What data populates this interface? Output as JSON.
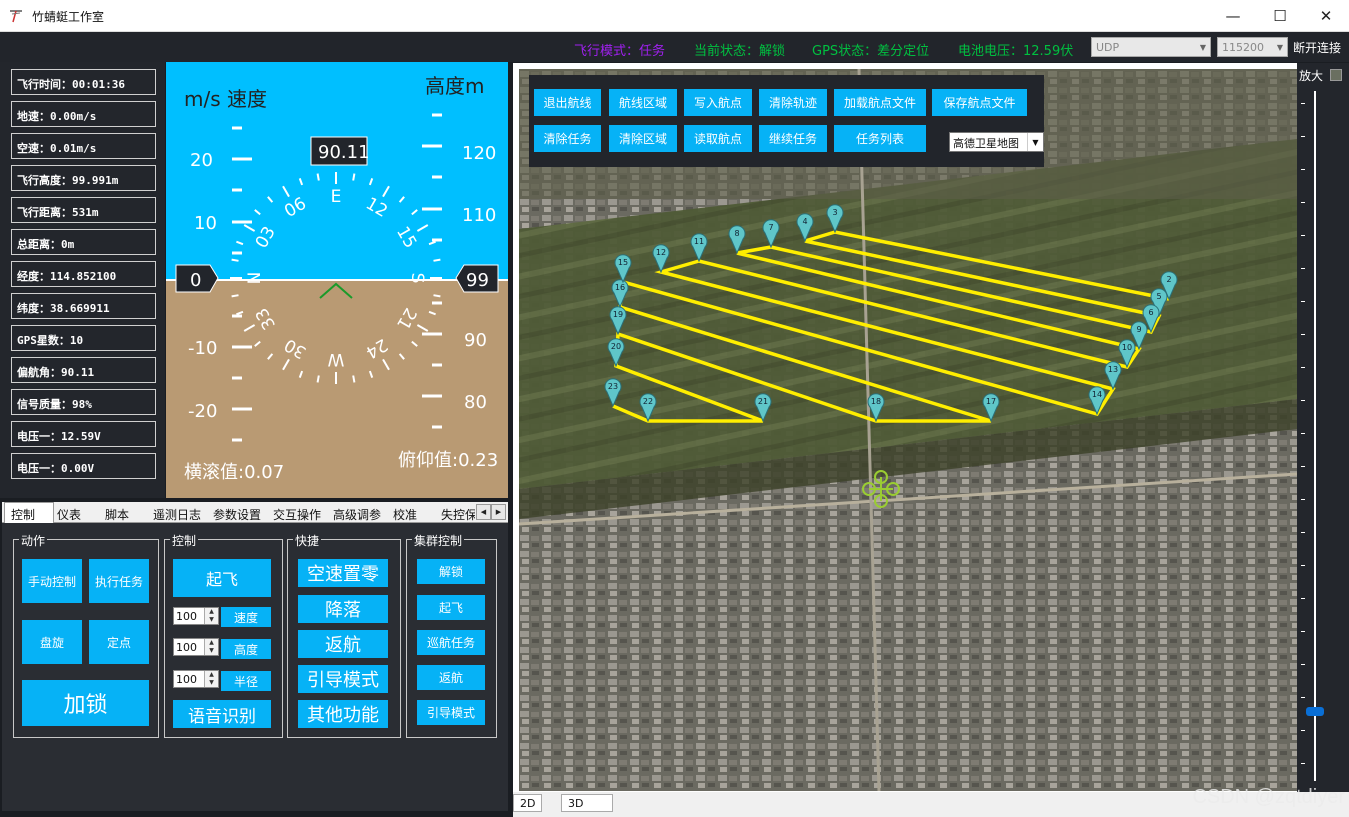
{
  "window": {
    "title": "竹蜻蜓工作室",
    "minimize": "—",
    "maximize": "☐",
    "close": "✕"
  },
  "status": {
    "flight_mode": "飞行模式：任务",
    "current_state": "当前状态：解锁",
    "gps_state": "GPS状态：差分定位",
    "battery": "电池电压：12.59伏",
    "protocol": "UDP",
    "baud": "115200",
    "disconnect": "断开连接",
    "colors": {
      "flight_mode": "#a020f0",
      "current_state": "#00c040",
      "gps_state": "#00c040",
      "battery": "#00c040"
    }
  },
  "telemetry": [
    "飞行时间：00:01:36",
    "地速：0.00m/s",
    "空速：0.01m/s",
    "飞行高度：99.991m",
    "飞行距离：531m",
    "总距离：0m",
    "经度：114.852100",
    "纬度：38.669911",
    "GPS星数：10",
    "偏航角：90.11",
    "信号质量：98%",
    "电压一：12.59V",
    "电压一：0.00V"
  ],
  "hud": {
    "speed_label": "m/s 速度",
    "alt_label": "高度m",
    "heading": "90.11",
    "speed_value": "0",
    "alt_value": "99",
    "roll": "横滚值:0.07",
    "pitch": "俯仰值:0.23",
    "speed_ticks": [
      "20",
      "10",
      "-10",
      "-20"
    ],
    "alt_ticks": [
      "120",
      "110",
      "90",
      "80"
    ],
    "compass": [
      "E",
      "12",
      "15",
      "S",
      "21",
      "24",
      "W",
      "30",
      "33",
      "N",
      "03",
      "06"
    ],
    "sky_color": "#00bfff",
    "ground_color": "#b99a73"
  },
  "tabs": [
    "控制",
    "仪表",
    "脚本",
    "遥测日志",
    "参数设置",
    "交互操作",
    "高级调参",
    "校准",
    "失控保"
  ],
  "groups": {
    "action": "动作",
    "control": "控制",
    "quick": "快捷",
    "swarm": "集群控制"
  },
  "action_buttons": [
    "手动控制",
    "执行任务",
    "盘旋",
    "定点",
    "加锁"
  ],
  "control": {
    "takeoff": "起飞",
    "speed_val": "100",
    "speed_btn": "速度",
    "alt_val": "100",
    "alt_btn": "高度",
    "radius_val": "100",
    "radius_btn": "半径",
    "voice": "语音识别"
  },
  "quick_buttons": [
    "空速置零",
    "降落",
    "返航",
    "引导模式",
    "其他功能"
  ],
  "swarm_buttons": [
    "解锁",
    "起飞",
    "巡航任务",
    "返航",
    "引导模式"
  ],
  "map_toolbar": {
    "row1": [
      "退出航线",
      "航线区域",
      "写入航点",
      "清除轨迹",
      "加载航点文件",
      "保存航点文件"
    ],
    "row2": [
      "清除任务",
      "清除区域",
      "读取航点",
      "继续任务",
      "任务列表"
    ],
    "map_type": "高德卫星地图"
  },
  "map": {
    "zoom_label": "放大",
    "zoom_level": 0.1,
    "waypoints": [
      "2",
      "5",
      "6",
      "9",
      "10",
      "13",
      "14",
      "17",
      "18",
      "21",
      "22",
      "23",
      "20",
      "19",
      "16",
      "15",
      "12",
      "11",
      "8",
      "7",
      "4",
      "3"
    ],
    "route_color": "#ffee00"
  },
  "map_tabs": [
    "2D",
    "3D"
  ],
  "watermark": "CSDN @zqtdiyer"
}
